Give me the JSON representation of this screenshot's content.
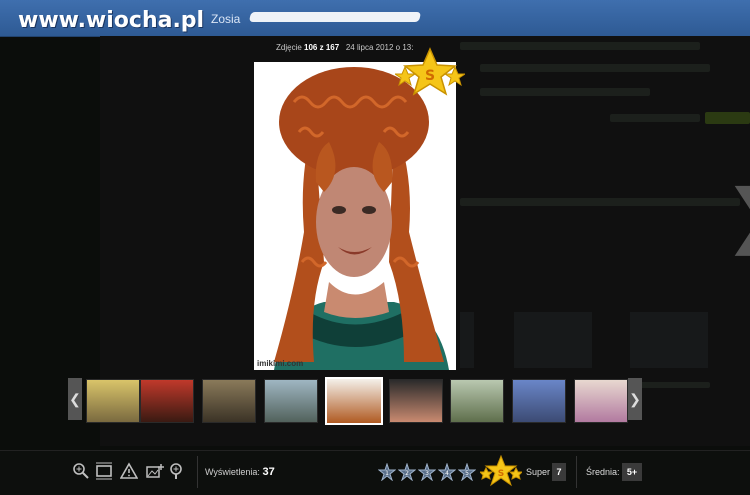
{
  "header": {
    "logo": "www.wiocha.pl",
    "username": "Zosia"
  },
  "photo": {
    "caption_prefix": "Zdjęcie",
    "index": "106 z 167",
    "date": "24 lipca 2012 o 13:",
    "watermark": "imikimi.com"
  },
  "thumbnails": {
    "prev": "❮",
    "next": "❯",
    "count": 9,
    "active_index": 4
  },
  "toolbar": {
    "views_label": "Wyświetlenia:",
    "views_count": "37",
    "super_label": "Super",
    "super_count": "7",
    "average_label": "Średnia:",
    "average_value": "5+",
    "rating_stars": [
      "1",
      "2",
      "3",
      "4",
      "5"
    ]
  },
  "colors": {
    "topbar": "#3a67a6",
    "accent_star": "#f5c518"
  },
  "icons": [
    "zoom-in-icon",
    "fit-screen-icon",
    "report-icon",
    "add-image-icon",
    "zoom-add-icon"
  ]
}
